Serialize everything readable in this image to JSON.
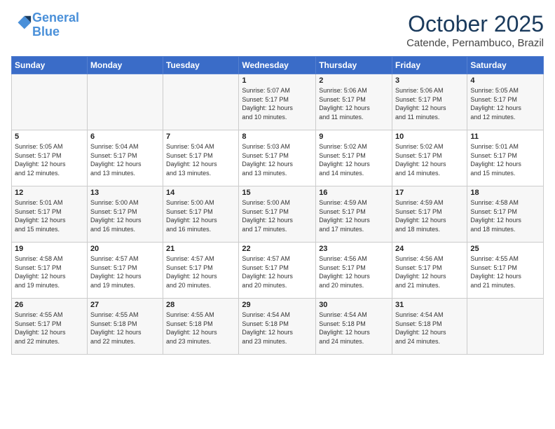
{
  "logo": {
    "line1": "General",
    "line2": "Blue"
  },
  "header": {
    "month": "October 2025",
    "location": "Catende, Pernambuco, Brazil"
  },
  "weekdays": [
    "Sunday",
    "Monday",
    "Tuesday",
    "Wednesday",
    "Thursday",
    "Friday",
    "Saturday"
  ],
  "weeks": [
    [
      {
        "day": "",
        "info": ""
      },
      {
        "day": "",
        "info": ""
      },
      {
        "day": "",
        "info": ""
      },
      {
        "day": "1",
        "info": "Sunrise: 5:07 AM\nSunset: 5:17 PM\nDaylight: 12 hours\nand 10 minutes."
      },
      {
        "day": "2",
        "info": "Sunrise: 5:06 AM\nSunset: 5:17 PM\nDaylight: 12 hours\nand 11 minutes."
      },
      {
        "day": "3",
        "info": "Sunrise: 5:06 AM\nSunset: 5:17 PM\nDaylight: 12 hours\nand 11 minutes."
      },
      {
        "day": "4",
        "info": "Sunrise: 5:05 AM\nSunset: 5:17 PM\nDaylight: 12 hours\nand 12 minutes."
      }
    ],
    [
      {
        "day": "5",
        "info": "Sunrise: 5:05 AM\nSunset: 5:17 PM\nDaylight: 12 hours\nand 12 minutes."
      },
      {
        "day": "6",
        "info": "Sunrise: 5:04 AM\nSunset: 5:17 PM\nDaylight: 12 hours\nand 13 minutes."
      },
      {
        "day": "7",
        "info": "Sunrise: 5:04 AM\nSunset: 5:17 PM\nDaylight: 12 hours\nand 13 minutes."
      },
      {
        "day": "8",
        "info": "Sunrise: 5:03 AM\nSunset: 5:17 PM\nDaylight: 12 hours\nand 13 minutes."
      },
      {
        "day": "9",
        "info": "Sunrise: 5:02 AM\nSunset: 5:17 PM\nDaylight: 12 hours\nand 14 minutes."
      },
      {
        "day": "10",
        "info": "Sunrise: 5:02 AM\nSunset: 5:17 PM\nDaylight: 12 hours\nand 14 minutes."
      },
      {
        "day": "11",
        "info": "Sunrise: 5:01 AM\nSunset: 5:17 PM\nDaylight: 12 hours\nand 15 minutes."
      }
    ],
    [
      {
        "day": "12",
        "info": "Sunrise: 5:01 AM\nSunset: 5:17 PM\nDaylight: 12 hours\nand 15 minutes."
      },
      {
        "day": "13",
        "info": "Sunrise: 5:00 AM\nSunset: 5:17 PM\nDaylight: 12 hours\nand 16 minutes."
      },
      {
        "day": "14",
        "info": "Sunrise: 5:00 AM\nSunset: 5:17 PM\nDaylight: 12 hours\nand 16 minutes."
      },
      {
        "day": "15",
        "info": "Sunrise: 5:00 AM\nSunset: 5:17 PM\nDaylight: 12 hours\nand 17 minutes."
      },
      {
        "day": "16",
        "info": "Sunrise: 4:59 AM\nSunset: 5:17 PM\nDaylight: 12 hours\nand 17 minutes."
      },
      {
        "day": "17",
        "info": "Sunrise: 4:59 AM\nSunset: 5:17 PM\nDaylight: 12 hours\nand 18 minutes."
      },
      {
        "day": "18",
        "info": "Sunrise: 4:58 AM\nSunset: 5:17 PM\nDaylight: 12 hours\nand 18 minutes."
      }
    ],
    [
      {
        "day": "19",
        "info": "Sunrise: 4:58 AM\nSunset: 5:17 PM\nDaylight: 12 hours\nand 19 minutes."
      },
      {
        "day": "20",
        "info": "Sunrise: 4:57 AM\nSunset: 5:17 PM\nDaylight: 12 hours\nand 19 minutes."
      },
      {
        "day": "21",
        "info": "Sunrise: 4:57 AM\nSunset: 5:17 PM\nDaylight: 12 hours\nand 20 minutes."
      },
      {
        "day": "22",
        "info": "Sunrise: 4:57 AM\nSunset: 5:17 PM\nDaylight: 12 hours\nand 20 minutes."
      },
      {
        "day": "23",
        "info": "Sunrise: 4:56 AM\nSunset: 5:17 PM\nDaylight: 12 hours\nand 20 minutes."
      },
      {
        "day": "24",
        "info": "Sunrise: 4:56 AM\nSunset: 5:17 PM\nDaylight: 12 hours\nand 21 minutes."
      },
      {
        "day": "25",
        "info": "Sunrise: 4:55 AM\nSunset: 5:17 PM\nDaylight: 12 hours\nand 21 minutes."
      }
    ],
    [
      {
        "day": "26",
        "info": "Sunrise: 4:55 AM\nSunset: 5:17 PM\nDaylight: 12 hours\nand 22 minutes."
      },
      {
        "day": "27",
        "info": "Sunrise: 4:55 AM\nSunset: 5:18 PM\nDaylight: 12 hours\nand 22 minutes."
      },
      {
        "day": "28",
        "info": "Sunrise: 4:55 AM\nSunset: 5:18 PM\nDaylight: 12 hours\nand 23 minutes."
      },
      {
        "day": "29",
        "info": "Sunrise: 4:54 AM\nSunset: 5:18 PM\nDaylight: 12 hours\nand 23 minutes."
      },
      {
        "day": "30",
        "info": "Sunrise: 4:54 AM\nSunset: 5:18 PM\nDaylight: 12 hours\nand 24 minutes."
      },
      {
        "day": "31",
        "info": "Sunrise: 4:54 AM\nSunset: 5:18 PM\nDaylight: 12 hours\nand 24 minutes."
      },
      {
        "day": "",
        "info": ""
      }
    ]
  ]
}
